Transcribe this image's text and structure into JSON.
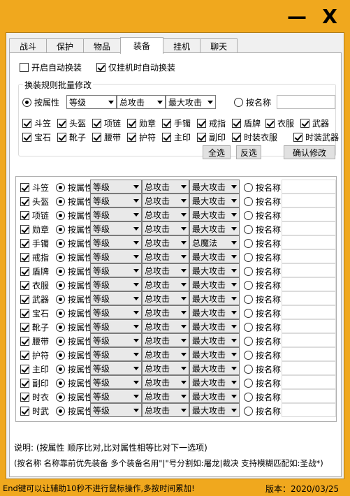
{
  "titlebar": {
    "minimize_label": "—",
    "close_label": "X"
  },
  "tabs": [
    {
      "label": "战斗",
      "active": false
    },
    {
      "label": "保护",
      "active": false
    },
    {
      "label": "物品",
      "active": false
    },
    {
      "label": "装备",
      "active": true
    },
    {
      "label": "挂机",
      "active": false
    },
    {
      "label": "聊天",
      "active": false
    }
  ],
  "options": {
    "auto_equip_label": "开启自动换装",
    "auto_equip_checked": false,
    "only_afk_label": "仅挂机时自动换装",
    "only_afk_checked": true
  },
  "batch": {
    "title": "换装规则批量修改",
    "by_attr_label": "按属性",
    "by_attr_selected": true,
    "select1": "等级",
    "select2": "总攻击",
    "select3": "最大攻击",
    "by_name_label": "按名称",
    "name_value": "",
    "slots": [
      {
        "label": "斗笠",
        "checked": true
      },
      {
        "label": "头盔",
        "checked": true
      },
      {
        "label": "项链",
        "checked": true
      },
      {
        "label": "勋章",
        "checked": true
      },
      {
        "label": "手镯",
        "checked": true
      },
      {
        "label": "戒指",
        "checked": true
      },
      {
        "label": "盾牌",
        "checked": true
      },
      {
        "label": "衣服",
        "checked": true
      },
      {
        "label": "武器",
        "checked": true
      },
      {
        "label": "宝石",
        "checked": true
      },
      {
        "label": "靴子",
        "checked": true
      },
      {
        "label": "腰带",
        "checked": true
      },
      {
        "label": "护符",
        "checked": true
      },
      {
        "label": "主印",
        "checked": true
      },
      {
        "label": "副印",
        "checked": true
      },
      {
        "label": "时装衣服",
        "checked": true
      },
      {
        "label": "时装武器",
        "checked": true
      }
    ],
    "select_all_label": "全选",
    "invert_label": "反选",
    "confirm_label": "确认修改"
  },
  "rows": [
    {
      "slot": "斗笠",
      "checked": true,
      "attr_label": "按属性",
      "s1": "等级",
      "s2": "总攻击",
      "s3": "最大攻击",
      "name_label": "按名称"
    },
    {
      "slot": "头盔",
      "checked": true,
      "attr_label": "按属性",
      "s1": "等级",
      "s2": "总攻击",
      "s3": "最大攻击",
      "name_label": "按名称"
    },
    {
      "slot": "项链",
      "checked": true,
      "attr_label": "按属性",
      "s1": "等级",
      "s2": "总攻击",
      "s3": "最大攻击",
      "name_label": "按名称"
    },
    {
      "slot": "勋章",
      "checked": true,
      "attr_label": "按属性",
      "s1": "等级",
      "s2": "总攻击",
      "s3": "最大攻击",
      "name_label": "按名称"
    },
    {
      "slot": "手镯",
      "checked": true,
      "attr_label": "按属性",
      "s1": "等级",
      "s2": "总攻击",
      "s3": "总魔法",
      "name_label": "按名称"
    },
    {
      "slot": "戒指",
      "checked": true,
      "attr_label": "按属性",
      "s1": "等级",
      "s2": "总攻击",
      "s3": "最大攻击",
      "name_label": "按名称"
    },
    {
      "slot": "盾牌",
      "checked": true,
      "attr_label": "按属性",
      "s1": "等级",
      "s2": "总攻击",
      "s3": "最大攻击",
      "name_label": "按名称"
    },
    {
      "slot": "衣服",
      "checked": true,
      "attr_label": "按属性",
      "s1": "等级",
      "s2": "总攻击",
      "s3": "最大攻击",
      "name_label": "按名称"
    },
    {
      "slot": "武器",
      "checked": true,
      "attr_label": "按属性",
      "s1": "等级",
      "s2": "总攻击",
      "s3": "最大攻击",
      "name_label": "按名称"
    },
    {
      "slot": "宝石",
      "checked": true,
      "attr_label": "按属性",
      "s1": "等级",
      "s2": "总攻击",
      "s3": "最大攻击",
      "name_label": "按名称"
    },
    {
      "slot": "靴子",
      "checked": true,
      "attr_label": "按属性",
      "s1": "等级",
      "s2": "总攻击",
      "s3": "最大攻击",
      "name_label": "按名称"
    },
    {
      "slot": "腰带",
      "checked": true,
      "attr_label": "按属性",
      "s1": "等级",
      "s2": "总攻击",
      "s3": "最大攻击",
      "name_label": "按名称"
    },
    {
      "slot": "护符",
      "checked": true,
      "attr_label": "按属性",
      "s1": "等级",
      "s2": "总攻击",
      "s3": "最大攻击",
      "name_label": "按名称"
    },
    {
      "slot": "主印",
      "checked": true,
      "attr_label": "按属性",
      "s1": "等级",
      "s2": "总攻击",
      "s3": "最大攻击",
      "name_label": "按名称"
    },
    {
      "slot": "副印",
      "checked": true,
      "attr_label": "按属性",
      "s1": "等级",
      "s2": "总攻击",
      "s3": "最大攻击",
      "name_label": "按名称"
    },
    {
      "slot": "时衣",
      "checked": true,
      "attr_label": "按属性",
      "s1": "等级",
      "s2": "总攻击",
      "s3": "最大攻击",
      "name_label": "按名称"
    },
    {
      "slot": "时武",
      "checked": true,
      "attr_label": "按属性",
      "s1": "等级",
      "s2": "总攻击",
      "s3": "最大攻击",
      "name_label": "按名称"
    }
  ],
  "notes": {
    "line1": "说明:   (按属性 顺序比对,比对属性相等比对下一选项)",
    "line2": "(按名称 名称靠前优先装备 多个装备名用\"|\"号分割如:屠龙|裁决 支持模糊匹配如:圣战*)"
  },
  "status": {
    "hint": "End键可以让辅助10秒不进行鼠标操作,多按时间累加!",
    "version": "版本：2020/03/25"
  }
}
